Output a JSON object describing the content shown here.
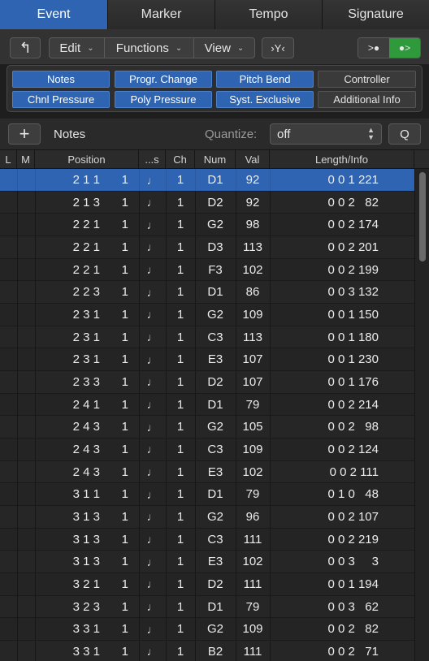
{
  "tabs": [
    "Event",
    "Marker",
    "Tempo",
    "Signature"
  ],
  "toolbar": {
    "menus": [
      {
        "label": "Edit"
      },
      {
        "label": "Functions"
      },
      {
        "label": "View"
      }
    ],
    "up_icon": "↰",
    "filter_icon": "›Y‹",
    "midi_in_icon": ">●",
    "midi_out_icon": "●>",
    "chevron": "⌄"
  },
  "filters": [
    {
      "label": "Notes",
      "on": true
    },
    {
      "label": "Progr. Change",
      "on": true
    },
    {
      "label": "Pitch Bend",
      "on": true
    },
    {
      "label": "Controller",
      "on": false
    },
    {
      "label": "Chnl Pressure",
      "on": true
    },
    {
      "label": "Poly Pressure",
      "on": true
    },
    {
      "label": "Syst. Exclusive",
      "on": true
    },
    {
      "label": "Additional Info",
      "on": false
    }
  ],
  "notesbar": {
    "plus": "+",
    "title": "Notes",
    "quantize_label": "Quantize:",
    "quantize_value": "off",
    "q_button": "Q"
  },
  "columns": [
    "L",
    "M",
    "Position",
    "...s",
    "Ch",
    "Num",
    "Val",
    "Length/Info"
  ],
  "rows": [
    {
      "pos": "2 1 1",
      "sub": "1",
      "ch": "1",
      "num": "D1",
      "val": "92",
      "len": "0 0 1 221"
    },
    {
      "pos": "2 1 3",
      "sub": "1",
      "ch": "1",
      "num": "D2",
      "val": "92",
      "len": "0 0 2   82"
    },
    {
      "pos": "2 2 1",
      "sub": "1",
      "ch": "1",
      "num": "G2",
      "val": "98",
      "len": "0 0 2 174"
    },
    {
      "pos": "2 2 1",
      "sub": "1",
      "ch": "1",
      "num": "D3",
      "val": "113",
      "len": "0 0 2 201"
    },
    {
      "pos": "2 2 1",
      "sub": "1",
      "ch": "1",
      "num": "F3",
      "val": "102",
      "len": "0 0 2 199"
    },
    {
      "pos": "2 2 3",
      "sub": "1",
      "ch": "1",
      "num": "D1",
      "val": "86",
      "len": "0 0 3 132"
    },
    {
      "pos": "2 3 1",
      "sub": "1",
      "ch": "1",
      "num": "G2",
      "val": "109",
      "len": "0 0 1 150"
    },
    {
      "pos": "2 3 1",
      "sub": "1",
      "ch": "1",
      "num": "C3",
      "val": "113",
      "len": "0 0 1 180"
    },
    {
      "pos": "2 3 1",
      "sub": "1",
      "ch": "1",
      "num": "E3",
      "val": "107",
      "len": "0 0 1 230"
    },
    {
      "pos": "2 3 3",
      "sub": "1",
      "ch": "1",
      "num": "D2",
      "val": "107",
      "len": "0 0 1 176"
    },
    {
      "pos": "2 4 1",
      "sub": "1",
      "ch": "1",
      "num": "D1",
      "val": "79",
      "len": "0 0 2 214"
    },
    {
      "pos": "2 4 3",
      "sub": "1",
      "ch": "1",
      "num": "G2",
      "val": "105",
      "len": "0 0 2   98"
    },
    {
      "pos": "2 4 3",
      "sub": "1",
      "ch": "1",
      "num": "C3",
      "val": "109",
      "len": "0 0 2 124"
    },
    {
      "pos": "2 4 3",
      "sub": "1",
      "ch": "1",
      "num": "E3",
      "val": "102",
      "len": "0 0 2 111"
    },
    {
      "pos": "3 1 1",
      "sub": "1",
      "ch": "1",
      "num": "D1",
      "val": "79",
      "len": "0 1 0   48"
    },
    {
      "pos": "3 1 3",
      "sub": "1",
      "ch": "1",
      "num": "G2",
      "val": "96",
      "len": "0 0 2 107"
    },
    {
      "pos": "3 1 3",
      "sub": "1",
      "ch": "1",
      "num": "C3",
      "val": "111",
      "len": "0 0 2 219"
    },
    {
      "pos": "3 1 3",
      "sub": "1",
      "ch": "1",
      "num": "E3",
      "val": "102",
      "len": "0 0 3     3"
    },
    {
      "pos": "3 2 1",
      "sub": "1",
      "ch": "1",
      "num": "D2",
      "val": "111",
      "len": "0 0 1 194"
    },
    {
      "pos": "3 2 3",
      "sub": "1",
      "ch": "1",
      "num": "D1",
      "val": "79",
      "len": "0 0 3   62"
    },
    {
      "pos": "3 3 1",
      "sub": "1",
      "ch": "1",
      "num": "G2",
      "val": "109",
      "len": "0 0 2   82"
    },
    {
      "pos": "3 3 1",
      "sub": "1",
      "ch": "1",
      "num": "B2",
      "val": "111",
      "len": "0 0 2   71"
    }
  ],
  "note_glyph": "♩",
  "selected_row": 0,
  "colors": {
    "accent": "#2e64b2",
    "midi_out_active": "#2f9a3b"
  }
}
